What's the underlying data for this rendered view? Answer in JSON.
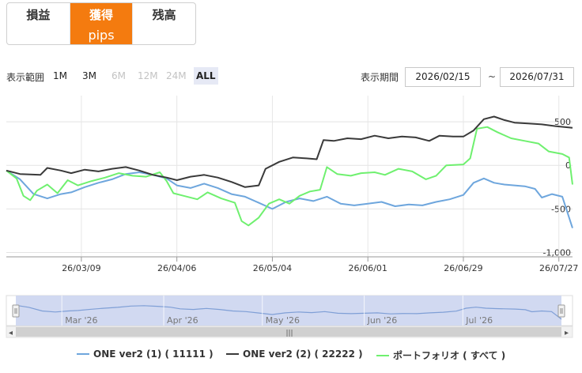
{
  "tabs": [
    {
      "label": "損益",
      "sub": ""
    },
    {
      "label": "獲得",
      "sub": "pips"
    },
    {
      "label": "残高",
      "sub": ""
    }
  ],
  "active_tab": 1,
  "range": {
    "label": "表示範囲",
    "buttons": [
      "1M",
      "3M",
      "6M",
      "12M",
      "24M",
      "ALL"
    ],
    "disabled": [
      "6M",
      "12M",
      "24M"
    ],
    "selected": "ALL"
  },
  "period": {
    "label": "表示期間",
    "from": "2026/02/15",
    "separator": "~",
    "to": "2026/07/31"
  },
  "colors": {
    "active_tab": "#f47b0f",
    "series1": "#6ea6dd",
    "series2": "#3a3a3a",
    "series3": "#6ff06f",
    "navigator_fill": "#ccd5ef",
    "navigator_line": "#7f9fd6"
  },
  "chart_data": {
    "type": "line",
    "x_start": "2026-02-15",
    "x_end": "2026-07-31",
    "x_ticks": [
      "26/03/09",
      "26/04/06",
      "26/05/04",
      "26/06/01",
      "26/06/29",
      "26/07/27"
    ],
    "y_ticks": [
      "500",
      "0",
      "-500",
      "-1,000"
    ],
    "ylim": [
      -1050,
      800
    ],
    "grid": true,
    "legend_position": "bottom",
    "series": [
      {
        "name": "ONE ver2 (1) ( 11111 )",
        "color": "#6ea6dd",
        "points": [
          [
            "2026-02-15",
            -60
          ],
          [
            "2026-02-19",
            -160
          ],
          [
            "2026-02-23",
            -330
          ],
          [
            "2026-02-27",
            -380
          ],
          [
            "2026-03-03",
            -330
          ],
          [
            "2026-03-06",
            -310
          ],
          [
            "2026-03-10",
            -250
          ],
          [
            "2026-03-14",
            -200
          ],
          [
            "2026-03-18",
            -160
          ],
          [
            "2026-03-22",
            -100
          ],
          [
            "2026-03-26",
            -80
          ],
          [
            "2026-03-30",
            -110
          ],
          [
            "2026-04-03",
            -150
          ],
          [
            "2026-04-06",
            -230
          ],
          [
            "2026-04-10",
            -260
          ],
          [
            "2026-04-14",
            -210
          ],
          [
            "2026-04-18",
            -260
          ],
          [
            "2026-04-22",
            -330
          ],
          [
            "2026-04-26",
            -360
          ],
          [
            "2026-04-30",
            -430
          ],
          [
            "2026-05-04",
            -500
          ],
          [
            "2026-05-08",
            -420
          ],
          [
            "2026-05-12",
            -380
          ],
          [
            "2026-05-16",
            -410
          ],
          [
            "2026-05-20",
            -360
          ],
          [
            "2026-05-24",
            -440
          ],
          [
            "2026-05-28",
            -460
          ],
          [
            "2026-06-01",
            -440
          ],
          [
            "2026-06-05",
            -420
          ],
          [
            "2026-06-09",
            -470
          ],
          [
            "2026-06-13",
            -450
          ],
          [
            "2026-06-17",
            -460
          ],
          [
            "2026-06-21",
            -420
          ],
          [
            "2026-06-25",
            -390
          ],
          [
            "2026-06-29",
            -340
          ],
          [
            "2026-07-02",
            -200
          ],
          [
            "2026-07-05",
            -150
          ],
          [
            "2026-07-08",
            -200
          ],
          [
            "2026-07-11",
            -220
          ],
          [
            "2026-07-14",
            -230
          ],
          [
            "2026-07-17",
            -240
          ],
          [
            "2026-07-20",
            -270
          ],
          [
            "2026-07-22",
            -370
          ],
          [
            "2026-07-25",
            -330
          ],
          [
            "2026-07-28",
            -360
          ],
          [
            "2026-07-31",
            -720
          ]
        ]
      },
      {
        "name": "ONE ver2 (2) ( 22222 )",
        "color": "#3a3a3a",
        "points": [
          [
            "2026-02-15",
            -60
          ],
          [
            "2026-02-19",
            -100
          ],
          [
            "2026-02-25",
            -110
          ],
          [
            "2026-02-27",
            -30
          ],
          [
            "2026-03-03",
            -60
          ],
          [
            "2026-03-06",
            -90
          ],
          [
            "2026-03-10",
            -50
          ],
          [
            "2026-03-14",
            -70
          ],
          [
            "2026-03-18",
            -40
          ],
          [
            "2026-03-22",
            -20
          ],
          [
            "2026-03-26",
            -60
          ],
          [
            "2026-03-30",
            -110
          ],
          [
            "2026-04-03",
            -140
          ],
          [
            "2026-04-06",
            -170
          ],
          [
            "2026-04-10",
            -130
          ],
          [
            "2026-04-14",
            -110
          ],
          [
            "2026-04-18",
            -140
          ],
          [
            "2026-04-22",
            -190
          ],
          [
            "2026-04-26",
            -250
          ],
          [
            "2026-04-30",
            -230
          ],
          [
            "2026-05-02",
            -40
          ],
          [
            "2026-05-06",
            40
          ],
          [
            "2026-05-10",
            90
          ],
          [
            "2026-05-14",
            80
          ],
          [
            "2026-05-17",
            70
          ],
          [
            "2026-05-19",
            290
          ],
          [
            "2026-05-22",
            280
          ],
          [
            "2026-05-26",
            310
          ],
          [
            "2026-05-30",
            300
          ],
          [
            "2026-06-03",
            340
          ],
          [
            "2026-06-07",
            310
          ],
          [
            "2026-06-11",
            330
          ],
          [
            "2026-06-15",
            320
          ],
          [
            "2026-06-19",
            280
          ],
          [
            "2026-06-22",
            340
          ],
          [
            "2026-06-26",
            330
          ],
          [
            "2026-06-29",
            330
          ],
          [
            "2026-07-02",
            400
          ],
          [
            "2026-07-05",
            530
          ],
          [
            "2026-07-08",
            560
          ],
          [
            "2026-07-11",
            520
          ],
          [
            "2026-07-14",
            490
          ],
          [
            "2026-07-18",
            480
          ],
          [
            "2026-07-22",
            470
          ],
          [
            "2026-07-26",
            450
          ],
          [
            "2026-07-31",
            430
          ]
        ]
      },
      {
        "name": "ポートフォリオ ( すべて )",
        "color": "#6ff06f",
        "points": [
          [
            "2026-02-15",
            -60
          ],
          [
            "2026-02-18",
            -150
          ],
          [
            "2026-02-20",
            -350
          ],
          [
            "2026-02-22",
            -400
          ],
          [
            "2026-02-24",
            -290
          ],
          [
            "2026-02-27",
            -220
          ],
          [
            "2026-03-02",
            -320
          ],
          [
            "2026-03-05",
            -170
          ],
          [
            "2026-03-08",
            -230
          ],
          [
            "2026-03-12",
            -180
          ],
          [
            "2026-03-16",
            -140
          ],
          [
            "2026-03-20",
            -90
          ],
          [
            "2026-03-24",
            -120
          ],
          [
            "2026-03-28",
            -130
          ],
          [
            "2026-04-01",
            -80
          ],
          [
            "2026-04-03",
            -180
          ],
          [
            "2026-04-05",
            -320
          ],
          [
            "2026-04-08",
            -350
          ],
          [
            "2026-04-12",
            -390
          ],
          [
            "2026-04-15",
            -310
          ],
          [
            "2026-04-19",
            -380
          ],
          [
            "2026-04-23",
            -430
          ],
          [
            "2026-04-25",
            -640
          ],
          [
            "2026-04-27",
            -690
          ],
          [
            "2026-04-30",
            -600
          ],
          [
            "2026-05-03",
            -440
          ],
          [
            "2026-05-06",
            -390
          ],
          [
            "2026-05-09",
            -440
          ],
          [
            "2026-05-12",
            -350
          ],
          [
            "2026-05-15",
            -300
          ],
          [
            "2026-05-18",
            -280
          ],
          [
            "2026-05-20",
            -20
          ],
          [
            "2026-05-23",
            -100
          ],
          [
            "2026-05-27",
            -120
          ],
          [
            "2026-05-30",
            -90
          ],
          [
            "2026-06-03",
            -80
          ],
          [
            "2026-06-06",
            -110
          ],
          [
            "2026-06-10",
            -40
          ],
          [
            "2026-06-14",
            -70
          ],
          [
            "2026-06-18",
            -160
          ],
          [
            "2026-06-21",
            -120
          ],
          [
            "2026-06-24",
            0
          ],
          [
            "2026-06-29",
            10
          ],
          [
            "2026-07-01",
            80
          ],
          [
            "2026-07-03",
            420
          ],
          [
            "2026-07-06",
            440
          ],
          [
            "2026-07-09",
            380
          ],
          [
            "2026-07-13",
            310
          ],
          [
            "2026-07-17",
            280
          ],
          [
            "2026-07-21",
            250
          ],
          [
            "2026-07-24",
            160
          ],
          [
            "2026-07-28",
            130
          ],
          [
            "2026-07-30",
            90
          ],
          [
            "2026-07-31",
            -220
          ]
        ]
      }
    ],
    "navigator": {
      "labels": [
        "Mar '26",
        "Apr '26",
        "May '26",
        "Jun '26",
        "Jul '26"
      ]
    }
  },
  "scrollbar": {
    "left_arrow": "◂",
    "right_arrow": "▸",
    "grip": "|||"
  }
}
